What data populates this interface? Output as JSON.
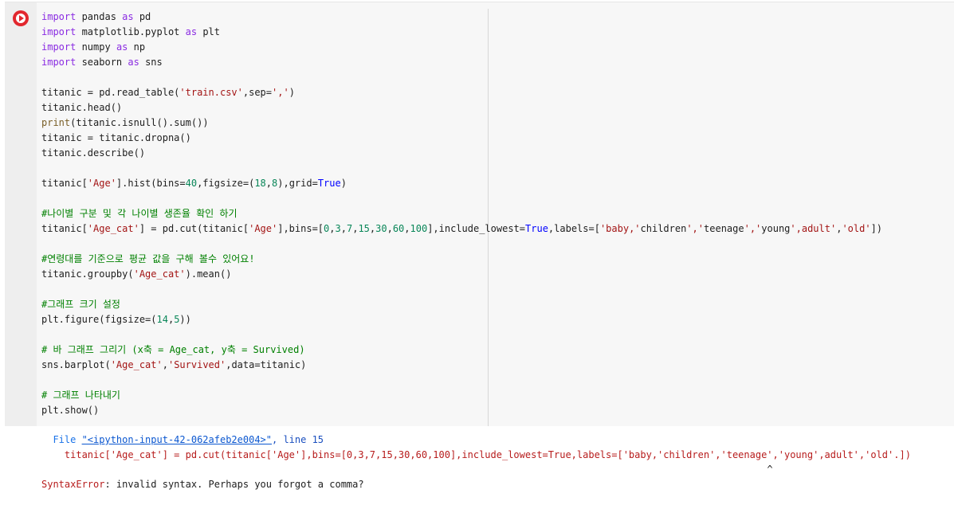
{
  "cell": {
    "run_button": "run-cell",
    "code_lines": [
      "import pandas as pd",
      "import matplotlib.pyplot as plt",
      "import numpy as np",
      "import seaborn as sns",
      "",
      "titanic = pd.read_table('train.csv',sep=',')",
      "titanic.head()",
      "print(titanic.isnull().sum())",
      "titanic = titanic.dropna()",
      "titanic.describe()",
      "",
      "titanic['Age'].hist(bins=40,figsize=(18,8),grid=True)",
      "",
      "#나이별 구분 및 각 나이별 생존율 확인 하기",
      "titanic['Age_cat'] = pd.cut(titanic['Age'],bins=[0,3,7,15,30,60,100],include_lowest=True,labels=['baby,'children','teenage','young',adult','old'])",
      "",
      "#연령대를 기준으로 평균 값을 구해 볼수 있어요!",
      "titanic.groupby('Age_cat').mean()",
      "",
      "#그래프 크기 설정",
      "plt.figure(figsize=(14,5))",
      "",
      "# 바 그래프 그리기 (x축 = Age_cat, y축 = Survived)",
      "sns.barplot('Age_cat','Survived',data=titanic)",
      "",
      "# 그래프 나타내기",
      "plt.show()"
    ]
  },
  "output": {
    "file_prefix": "File ",
    "file_link": "\"<ipython-input-42-062afeb2e004>\"",
    "line_sep": ", ",
    "line_label": "line 15",
    "code_echo": "titanic['Age_cat'] = pd.cut(titanic['Age'],bins=[0,3,7,15,30,60,100],include_lowest=True,labels=['baby,'children','teenage','young',adult','old'.])",
    "caret": "^",
    "error_name": "SyntaxError",
    "error_message": ": invalid syntax. Perhaps you forgot a comma?"
  },
  "colors": {
    "keyword": "#8a2be2",
    "string": "#a31515",
    "number": "#098658",
    "constant": "#0000ff",
    "comment": "#008000",
    "error": "#b71c1c",
    "run_button": "#e2272e"
  }
}
